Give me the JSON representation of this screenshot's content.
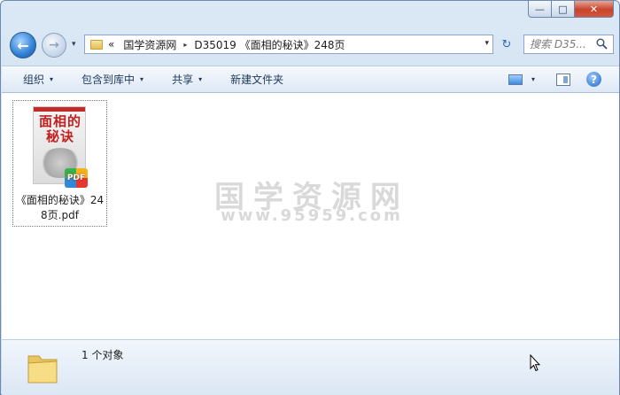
{
  "window": {
    "caption": {
      "minimize": "—",
      "maximize": "□",
      "close": "✕"
    }
  },
  "address_bar": {
    "overflow_chevron": "«",
    "crumbs": [
      "国学资源网",
      "D35019 《面相的秘诀》248页"
    ],
    "separator": "▸",
    "dropdown": "▾"
  },
  "nav": {
    "back": "←",
    "forward": "→",
    "history_dropdown": "▾",
    "refresh": "↻"
  },
  "search": {
    "placeholder": "搜索 D35..."
  },
  "toolbar": {
    "organize_label": "组织",
    "include_library_label": "包含到库中",
    "share_label": "共享",
    "new_folder_label": "新建文件夹",
    "dropdown_arrow": "▾",
    "help_glyph": "?"
  },
  "files": [
    {
      "name": "《面相的秘诀》248页.pdf",
      "thumbnail_title": "面相的秘诀",
      "badge": "PDF"
    }
  ],
  "watermark": {
    "text": "国学资源网",
    "url": "www.95959.com"
  },
  "details": {
    "count_text": "1 个对象"
  },
  "colors": {
    "chrome_blue": "#c9dcf0",
    "toolbar_text": "#1e395b",
    "close_red": "#c7442c",
    "thumbnail_red": "#c41f1f"
  }
}
